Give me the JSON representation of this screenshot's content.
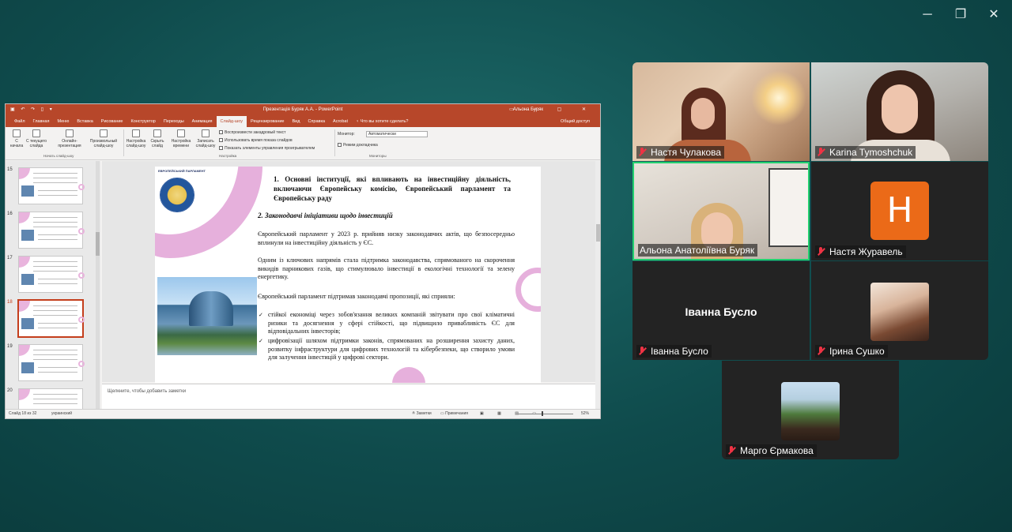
{
  "window_controls": {
    "minimize": "─",
    "maximize": "❐",
    "close": "✕"
  },
  "ppt": {
    "title": "Презентація Буряк А.А.  -  PowerPoint",
    "user": "Альона Буряк",
    "qat": "▣ ↶ ↷ ▯ ▾",
    "title_controls": "▭ − ▢ ✕",
    "tabs": [
      "Файл",
      "Главная",
      "Меню",
      "Вставка",
      "Рисование",
      "Конструктор",
      "Переходы",
      "Анимация",
      "Слайд-шоу",
      "Рецензирование",
      "Вид",
      "Справка",
      "Acrobat",
      "♀ Что вы хотите сделать?"
    ],
    "active_tab": "Слайд-шоу",
    "share": "Общий доступ",
    "ribbon": {
      "from_start": "С начала",
      "from_current": "С текущего слайда",
      "online": "Онлайн-презентация",
      "custom": "Произвольный слайд-шоу",
      "group_start": "Начать слайд-шоу",
      "setup": "Настройка слайд-шоу",
      "hide": "Скрыть слайд",
      "rehearse": "Настройка времени",
      "record": "Записать слайд-шоу",
      "chk_narration": "Воспроизвести закадровый текст",
      "chk_timings": "Использовать время показа слайдов",
      "chk_controls": "Показать элементы управления проигрывателем",
      "group_setup": "Настройка",
      "monitor_label": "Монитор:",
      "monitor_value": "Автоматически",
      "presenter_view": "Режим докладчика",
      "group_monitors": "Мониторы"
    },
    "thumb_numbers": [
      "15",
      "16",
      "17",
      "18",
      "19",
      "20"
    ],
    "selected_thumb": "18",
    "slide": {
      "logo_text": "ЕВРОПЕЙСЬКИЙ ПАРЛАМЕНТ",
      "heading": "1. Основні інституції, які впливають на інвестиційну діяльність, включаючи Європейську комісію, Європейський парламент та Європейську раду",
      "subheading": "2. Законодавчі ініціативи щодо інвестицій",
      "p1": "Європейський парламент у 2023 р. прийняв низку законодавчих актів, що безпосередньо вплинули на інвестиційну діяльність у ЄС.",
      "p2": "Одним із ключових напрямів стала підтримка законодавства, спрямованого на скорочення викидів парникових газів, що стимулювало інвестиції в екологічні технології та зелену енергетику.",
      "p3": "Європейський парламент підтримав законодавчі пропозиції, які сприяли:",
      "b1": "стійкої економіці через зобов'язання великих компаній звітувати про свої кліматичні ризики та досягнення у сфері стійкості, що підвищило привабливість ЄС для відповідальних інвесторів;",
      "b2": "цифровізації шляхом підтримки законів, спрямованих на розширення захисту даних, розвитку інфраструктури для цифрових технологій та кібербезпеки, що створило умови для залучення інвестицій у цифрові сектори."
    },
    "notes_placeholder": "Щелкните, чтобы добавить заметки",
    "status": {
      "slide": "Слайд 18 из 32",
      "language": "украинский",
      "notes": "≙ Заметки",
      "comments": "▭ Примечания",
      "views": "▣ ▦ ▤ ▭",
      "zoom": "52%"
    }
  },
  "participants": [
    {
      "name": "Настя Чулакова",
      "muted": true
    },
    {
      "name": "Karina Tymoshchuk",
      "muted": true
    },
    {
      "name": "Альона Анатоліївна Буряк",
      "muted": false,
      "speaking": true
    },
    {
      "name": "Настя Журавель",
      "muted": true,
      "avatar_letter": "H",
      "avatar_color": "#eb6a18"
    },
    {
      "name": "Іванна Бусло",
      "muted": true,
      "display_name": "Іванна Бусло"
    },
    {
      "name": "Ірина Сушко",
      "muted": true
    },
    {
      "name": "Марго Єрмакова",
      "muted": true
    }
  ],
  "colors": {
    "background": "#125353",
    "ppt_accent": "#b7472a",
    "speaking_border": "#23d16f"
  }
}
